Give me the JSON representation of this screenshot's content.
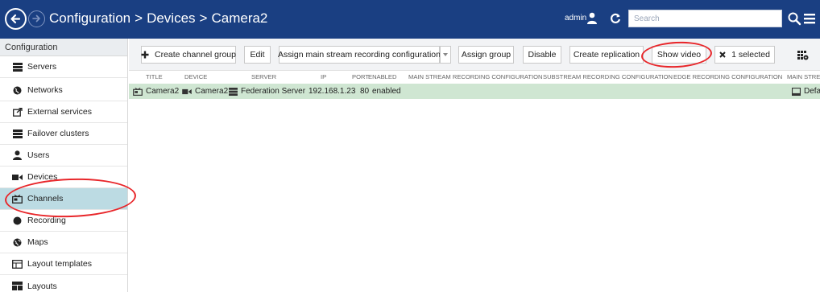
{
  "breadcrumb": [
    "Configuration",
    ">",
    "Devices",
    ">",
    "Camera2"
  ],
  "header": {
    "user": "admin",
    "search_placeholder": "Search"
  },
  "sidebar": {
    "heading": "Configuration",
    "items": [
      {
        "label": "Servers",
        "icon": "server-icon"
      },
      {
        "label": "Networks",
        "icon": "globe-icon"
      },
      {
        "label": "External services",
        "icon": "external-link-icon"
      },
      {
        "label": "Failover clusters",
        "icon": "cluster-icon"
      },
      {
        "label": "Users",
        "icon": "user-icon"
      },
      {
        "label": "Devices",
        "icon": "camera-icon"
      },
      {
        "label": "Channels",
        "icon": "channel-icon",
        "active": true
      },
      {
        "label": "Recording",
        "icon": "record-icon"
      },
      {
        "label": "Maps",
        "icon": "map-icon"
      },
      {
        "label": "Layout templates",
        "icon": "layout-template-icon"
      },
      {
        "label": "Layouts",
        "icon": "layouts-icon"
      }
    ]
  },
  "toolbar": {
    "create_channel_group": "Create channel group",
    "edit": "Edit",
    "assign_main_stream": "Assign main stream recording configuration",
    "assign_group": "Assign group",
    "disable": "Disable",
    "create_replication": "Create replication",
    "show_video": "Show video",
    "selected": "1 selected"
  },
  "table": {
    "columns": [
      "TITLE",
      "DEVICE",
      "SERVER",
      "IP",
      "PORT",
      "ENABLED",
      "MAIN STREAM RECORDING CONFIGURATION",
      "SUBSTREAM RECORDING CONFIGURATION",
      "EDGE RECORDING CONFIGURATION",
      "MAIN STRE"
    ],
    "rows": [
      {
        "title": "Camera2",
        "device": "Camera2",
        "server": "Federation Server",
        "ip": "192.168.1.23",
        "port": "80",
        "enabled": "enabled",
        "main_stream": "Default"
      }
    ]
  },
  "colors": {
    "topbar": "#1a3f82",
    "active_sidebar": "#bcdbe3",
    "selected_row": "#cfe6d2",
    "annotation": "#e8262a"
  }
}
